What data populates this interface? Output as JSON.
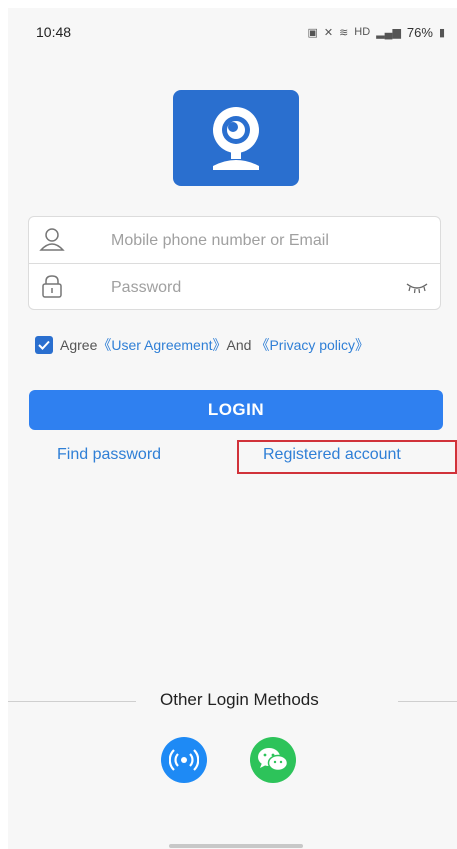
{
  "status_bar": {
    "time": "10:48",
    "battery": "76%",
    "network": "HD"
  },
  "login_form": {
    "account_placeholder": "Mobile phone number or Email",
    "password_placeholder": "Password"
  },
  "agreement": {
    "agree": "Agree",
    "user_agreement": "《User Agreement》",
    "and": "And",
    "privacy_policy": "《Privacy policy》",
    "checked": true
  },
  "login_button": "LOGIN",
  "links": {
    "find_password": "Find password",
    "registered_account": "Registered account"
  },
  "other_login": {
    "title": "Other Login Methods",
    "methods": [
      "wireless-signal-icon",
      "wechat-icon"
    ]
  },
  "colors": {
    "primary": "#2f80f0",
    "link": "#2f7fd6",
    "logo_bg": "#2a6fcf",
    "wechat": "#2dc35a",
    "highlight_box": "#d1323a"
  }
}
